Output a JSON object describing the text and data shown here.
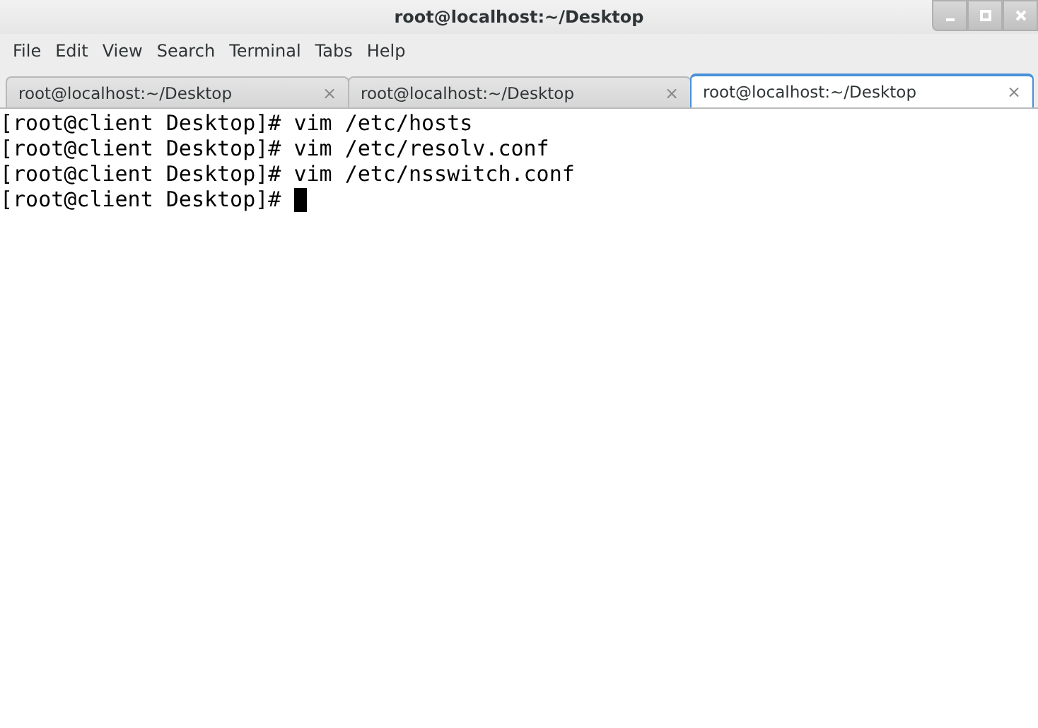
{
  "window": {
    "title": "root@localhost:~/Desktop"
  },
  "menu": [
    "File",
    "Edit",
    "View",
    "Search",
    "Terminal",
    "Tabs",
    "Help"
  ],
  "tabs": [
    {
      "label": "root@localhost:~/Desktop",
      "close": "×",
      "selected": false
    },
    {
      "label": "root@localhost:~/Desktop",
      "close": "×",
      "selected": false
    },
    {
      "label": "root@localhost:~/Desktop",
      "close": "×",
      "selected": true
    }
  ],
  "terminal": {
    "lines": [
      "[root@client Desktop]# vim /etc/hosts",
      "[root@client Desktop]# vim /etc/resolv.conf",
      "[root@client Desktop]# vim /etc/nsswitch.conf"
    ],
    "prompt": "[root@client Desktop]#"
  }
}
